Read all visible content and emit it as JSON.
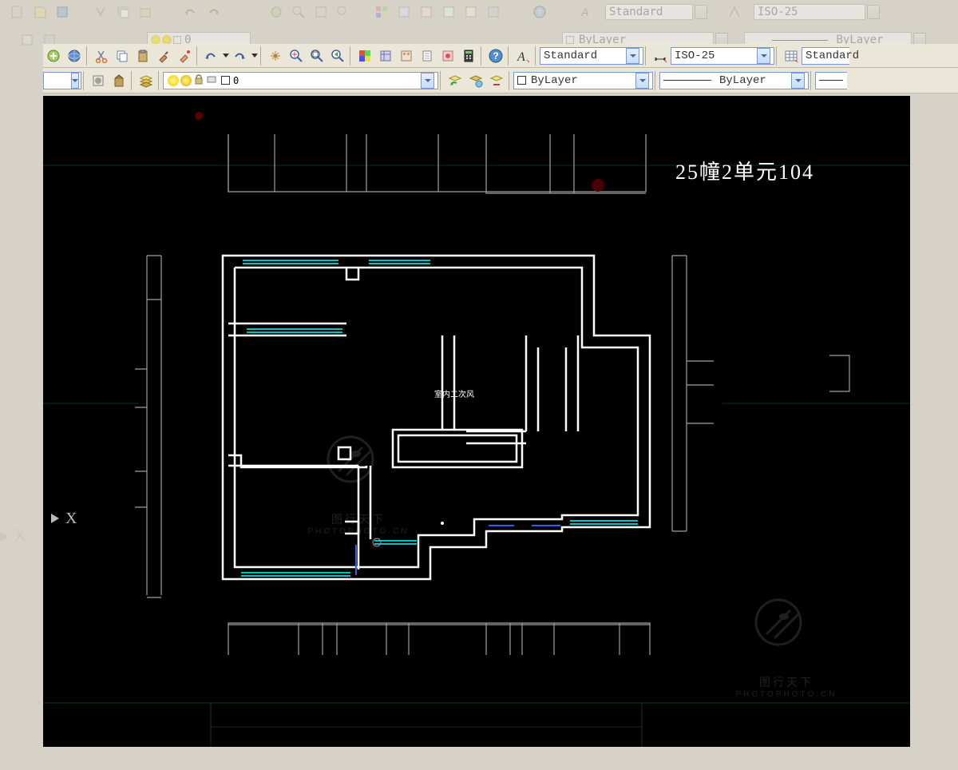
{
  "ghost_toolbar": {
    "text_style": "Standard",
    "dim_style": "ISO-25",
    "bylayer": "ByLayer",
    "layer_num": "0"
  },
  "toolbar": {
    "text_style": "Standard",
    "dim_style": "ISO-25",
    "table_style": "Standard",
    "color_label": "ByLayer",
    "linetype_label": "ByLayer",
    "layer_text": "0"
  },
  "drawing": {
    "title": "25幢2单元104",
    "center_label": "室内二次风",
    "axis_label": "X",
    "watermark_text": "图行天下",
    "watermark_url": "PHOTOPHOTO.CN"
  },
  "icons": {
    "new": "new-icon",
    "open": "open-icon",
    "save": "save-icon",
    "cut": "cut-icon",
    "copy": "copy-icon",
    "paste": "paste-icon",
    "match": "match-icon",
    "paint": "paint-icon",
    "undo": "undo-icon",
    "redo": "redo-icon",
    "pan": "pan-icon",
    "zoom_rt": "zoom-realtime-icon",
    "zoom_win": "zoom-window-icon",
    "zoom_prev": "zoom-previous-icon",
    "props": "properties-icon",
    "design_center": "design-center-icon",
    "tool_palette": "tool-palette-icon",
    "sheet_set": "sheet-set-icon",
    "markup": "markup-icon",
    "qcalc": "qcalc-icon",
    "help": "help-icon",
    "text_style_icon": "text-style-icon",
    "dim_style_icon": "dim-style-icon",
    "table_style_icon": "table-style-icon",
    "layer_mgr": "layer-manager-icon",
    "layer_prev": "layer-previous-icon",
    "layer_states": "layer-states-icon",
    "layer_tools": "layer-tools-icon"
  }
}
